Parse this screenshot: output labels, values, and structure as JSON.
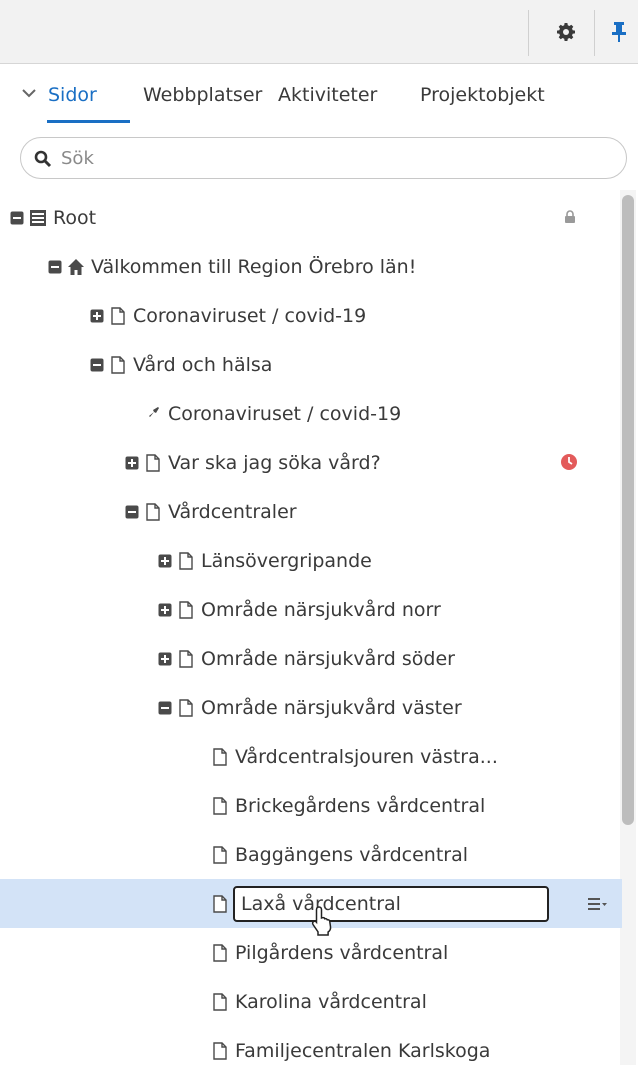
{
  "tabs": {
    "items": [
      {
        "label": "Sidor",
        "active": true
      },
      {
        "label": "Webbplatser"
      },
      {
        "label": "Aktiviteter"
      },
      {
        "label": "Projektobjekt"
      }
    ]
  },
  "search": {
    "placeholder": "Sök"
  },
  "tree": [
    {
      "label": "Root",
      "toggle": "minus",
      "icon": "root-list-icon",
      "badge": "lock-icon"
    },
    {
      "label": "Välkommen till Region Örebro län!",
      "toggle": "minus",
      "icon": "home-icon"
    },
    {
      "label": "Coronaviruset / covid-19",
      "toggle": "plus",
      "icon": "page-icon"
    },
    {
      "label": "Vård och hälsa",
      "toggle": "minus",
      "icon": "page-icon"
    },
    {
      "label": "Coronaviruset / covid-19",
      "toggle": "none",
      "icon": "shortcut-pin-icon"
    },
    {
      "label": "Var ska jag söka vård?",
      "toggle": "plus",
      "icon": "page-icon",
      "badge": "clock-alert-icon"
    },
    {
      "label": "Vårdcentraler",
      "toggle": "minus",
      "icon": "page-icon"
    },
    {
      "label": "Länsövergripande",
      "toggle": "plus",
      "icon": "page-icon"
    },
    {
      "label": "Område närsjukvård norr",
      "toggle": "plus",
      "icon": "page-icon"
    },
    {
      "label": "Område närsjukvård söder",
      "toggle": "plus",
      "icon": "page-icon"
    },
    {
      "label": "Område närsjukvård väster",
      "toggle": "minus",
      "icon": "page-icon"
    },
    {
      "label": "Vårdcentralsjouren västra...",
      "toggle": "none",
      "icon": "page-icon"
    },
    {
      "label": "Brickegårdens vårdcentral",
      "toggle": "none",
      "icon": "page-icon"
    },
    {
      "label": "Baggängens vårdcentral",
      "toggle": "none",
      "icon": "page-icon"
    },
    {
      "label": "Laxå vårdcentral",
      "toggle": "none",
      "icon": "page-icon",
      "selected": true,
      "editing": true
    },
    {
      "label": "Pilgårdens vårdcentral",
      "toggle": "none",
      "icon": "page-icon"
    },
    {
      "label": "Karolina vårdcentral",
      "toggle": "none",
      "icon": "page-icon"
    },
    {
      "label": "Familjecentralen Karlskoga",
      "toggle": "none",
      "icon": "page-icon"
    }
  ],
  "colors": {
    "accent": "#1a6fc4",
    "selected_row": "#d3e3f7",
    "alert": "#e35b5b"
  }
}
